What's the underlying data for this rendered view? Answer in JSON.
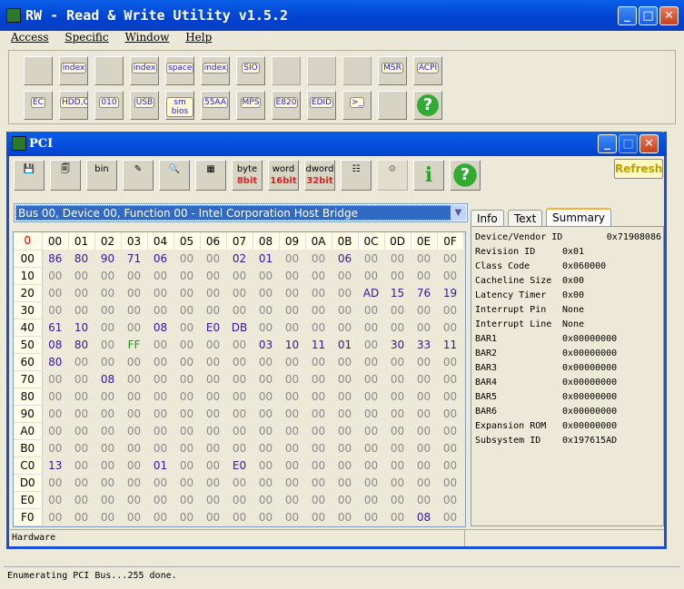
{
  "app": {
    "title": "RW - Read & Write Utility v1.5.2"
  },
  "menu": [
    "Access",
    "Specific",
    "Window",
    "Help"
  ],
  "toolbar_row1": [
    {
      "name": "pci-icon",
      "label": ""
    },
    {
      "name": "pci-index-icon",
      "label": "index"
    },
    {
      "name": "memory-icon",
      "label": ""
    },
    {
      "name": "memory-index-icon",
      "label": "index"
    },
    {
      "name": "io-space-icon",
      "label": "space"
    },
    {
      "name": "io-index-icon",
      "label": "index"
    },
    {
      "name": "sio-icon",
      "label": "SIO"
    },
    {
      "name": "disabled-icon",
      "label": "",
      "disabled": true
    },
    {
      "name": "disabled-icon",
      "label": "",
      "disabled": true
    },
    {
      "name": "disabled-icon",
      "label": "",
      "disabled": true
    },
    {
      "name": "msr-icon",
      "label": "MSR"
    },
    {
      "name": "acpi-icon",
      "label": "ACPI"
    }
  ],
  "toolbar_row2": [
    {
      "name": "ec-icon",
      "label": "EC"
    },
    {
      "name": "hdd-cd-icon",
      "label": "HDD,CD"
    },
    {
      "name": "disk-010-icon",
      "label": "010"
    },
    {
      "name": "usb-icon",
      "label": "USB"
    },
    {
      "name": "smbios-icon",
      "label": "sm bios"
    },
    {
      "name": "rom-55aa-icon",
      "label": "55AA"
    },
    {
      "name": "mps-icon",
      "label": "MPS"
    },
    {
      "name": "e820-icon",
      "label": "E820"
    },
    {
      "name": "edid-icon",
      "label": "EDID"
    },
    {
      "name": "command-icon",
      "label": ">_"
    },
    {
      "name": "hardware-icon",
      "label": ""
    },
    {
      "name": "help-icon",
      "label": "?"
    }
  ],
  "pci": {
    "title": "PCI",
    "toolbar": {
      "byte": "byte",
      "byte_bits": "8bit",
      "word": "word",
      "word_bits": "16bit",
      "dword": "dword",
      "dword_bits": "32bit",
      "info": "i",
      "help": "?",
      "refresh": "Refresh"
    },
    "device_select": "Bus 00, Device 00, Function 00 - Intel Corporation Host Bridge",
    "grid": {
      "corner": "0",
      "columns": [
        "00",
        "01",
        "02",
        "03",
        "04",
        "05",
        "06",
        "07",
        "08",
        "09",
        "0A",
        "0B",
        "0C",
        "0D",
        "0E",
        "0F"
      ],
      "rows": [
        {
          "offset": "00",
          "values": [
            "86",
            "80",
            "90",
            "71",
            "06",
            "00",
            "00",
            "02",
            "01",
            "00",
            "00",
            "06",
            "00",
            "00",
            "00",
            "00"
          ]
        },
        {
          "offset": "10",
          "values": [
            "00",
            "00",
            "00",
            "00",
            "00",
            "00",
            "00",
            "00",
            "00",
            "00",
            "00",
            "00",
            "00",
            "00",
            "00",
            "00"
          ]
        },
        {
          "offset": "20",
          "values": [
            "00",
            "00",
            "00",
            "00",
            "00",
            "00",
            "00",
            "00",
            "00",
            "00",
            "00",
            "00",
            "AD",
            "15",
            "76",
            "19"
          ]
        },
        {
          "offset": "30",
          "values": [
            "00",
            "00",
            "00",
            "00",
            "00",
            "00",
            "00",
            "00",
            "00",
            "00",
            "00",
            "00",
            "00",
            "00",
            "00",
            "00"
          ]
        },
        {
          "offset": "40",
          "values": [
            "61",
            "10",
            "00",
            "00",
            "08",
            "00",
            "E0",
            "DB",
            "00",
            "00",
            "00",
            "00",
            "00",
            "00",
            "00",
            "00"
          ]
        },
        {
          "offset": "50",
          "values": [
            "08",
            "80",
            "00",
            "FF",
            "00",
            "00",
            "00",
            "00",
            "03",
            "10",
            "11",
            "01",
            "00",
            "30",
            "33",
            "11"
          ]
        },
        {
          "offset": "60",
          "values": [
            "80",
            "00",
            "00",
            "00",
            "00",
            "00",
            "00",
            "00",
            "00",
            "00",
            "00",
            "00",
            "00",
            "00",
            "00",
            "00"
          ]
        },
        {
          "offset": "70",
          "values": [
            "00",
            "00",
            "08",
            "00",
            "00",
            "00",
            "00",
            "00",
            "00",
            "00",
            "00",
            "00",
            "00",
            "00",
            "00",
            "00"
          ]
        },
        {
          "offset": "80",
          "values": [
            "00",
            "00",
            "00",
            "00",
            "00",
            "00",
            "00",
            "00",
            "00",
            "00",
            "00",
            "00",
            "00",
            "00",
            "00",
            "00"
          ]
        },
        {
          "offset": "90",
          "values": [
            "00",
            "00",
            "00",
            "00",
            "00",
            "00",
            "00",
            "00",
            "00",
            "00",
            "00",
            "00",
            "00",
            "00",
            "00",
            "00"
          ]
        },
        {
          "offset": "A0",
          "values": [
            "00",
            "00",
            "00",
            "00",
            "00",
            "00",
            "00",
            "00",
            "00",
            "00",
            "00",
            "00",
            "00",
            "00",
            "00",
            "00"
          ]
        },
        {
          "offset": "B0",
          "values": [
            "00",
            "00",
            "00",
            "00",
            "00",
            "00",
            "00",
            "00",
            "00",
            "00",
            "00",
            "00",
            "00",
            "00",
            "00",
            "00"
          ]
        },
        {
          "offset": "C0",
          "values": [
            "13",
            "00",
            "00",
            "00",
            "01",
            "00",
            "00",
            "E0",
            "00",
            "00",
            "00",
            "00",
            "00",
            "00",
            "00",
            "00"
          ]
        },
        {
          "offset": "D0",
          "values": [
            "00",
            "00",
            "00",
            "00",
            "00",
            "00",
            "00",
            "00",
            "00",
            "00",
            "00",
            "00",
            "00",
            "00",
            "00",
            "00"
          ]
        },
        {
          "offset": "E0",
          "values": [
            "00",
            "00",
            "00",
            "00",
            "00",
            "00",
            "00",
            "00",
            "00",
            "00",
            "00",
            "00",
            "00",
            "00",
            "00",
            "00"
          ]
        },
        {
          "offset": "F0",
          "values": [
            "00",
            "00",
            "00",
            "00",
            "00",
            "00",
            "00",
            "00",
            "00",
            "00",
            "00",
            "00",
            "00",
            "00",
            "08",
            "00"
          ]
        }
      ]
    },
    "tabs": [
      {
        "label": "Info"
      },
      {
        "label": "Text"
      },
      {
        "label": "Summary",
        "active": true
      }
    ],
    "summary": [
      {
        "key": "Device/Vendor ID",
        "value": "0x71908086"
      },
      {
        "key": "Revision ID",
        "value": "0x01"
      },
      {
        "key": "Class Code",
        "value": "0x060000"
      },
      {
        "key": "Cacheline Size",
        "value": "0x00"
      },
      {
        "key": "Latency Timer",
        "value": "0x00"
      },
      {
        "key": "Interrupt Pin",
        "value": "None"
      },
      {
        "key": "Interrupt Line",
        "value": "None"
      },
      {
        "key": "BAR1",
        "value": "0x00000000"
      },
      {
        "key": "BAR2",
        "value": "0x00000000"
      },
      {
        "key": "BAR3",
        "value": "0x00000000"
      },
      {
        "key": "BAR4",
        "value": "0x00000000"
      },
      {
        "key": "BAR5",
        "value": "0x00000000"
      },
      {
        "key": "BAR6",
        "value": "0x00000000"
      },
      {
        "key": "Expansion ROM",
        "value": "0x00000000"
      },
      {
        "key": "Subsystem ID",
        "value": "0x197615AD"
      }
    ],
    "status": "Hardware"
  },
  "status": "Enumerating PCI Bus...255 done.",
  "colors": {
    "zero": "#8a8a8a",
    "nonzero": "#3a1499",
    "ff": "#139a13",
    "selection": "#316ac5",
    "titlebar": "#0a5fe8"
  }
}
